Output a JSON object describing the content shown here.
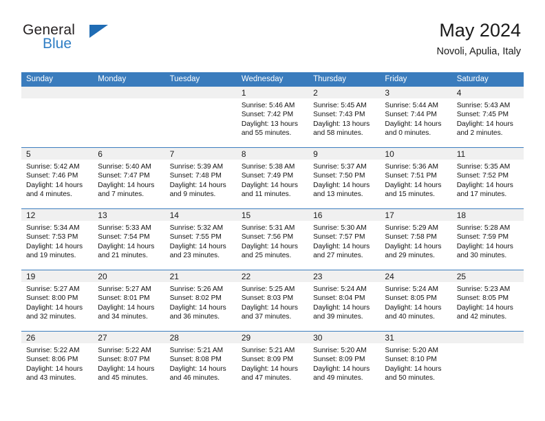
{
  "brand": {
    "name_part1": "General",
    "name_part2": "Blue",
    "logo_icon": "triangle-logo-icon",
    "accent_color": "#2e7dc4"
  },
  "header": {
    "month_title": "May 2024",
    "location": "Novoli, Apulia, Italy"
  },
  "calendar": {
    "header_color": "#3a7cbd",
    "daynum_band_color": "#f0f0f0",
    "weekday_labels": [
      "Sunday",
      "Monday",
      "Tuesday",
      "Wednesday",
      "Thursday",
      "Friday",
      "Saturday"
    ],
    "weeks": [
      [
        {
          "day": "",
          "sunrise": "",
          "sunset": "",
          "daylight_line1": "",
          "daylight_line2": ""
        },
        {
          "day": "",
          "sunrise": "",
          "sunset": "",
          "daylight_line1": "",
          "daylight_line2": ""
        },
        {
          "day": "",
          "sunrise": "",
          "sunset": "",
          "daylight_line1": "",
          "daylight_line2": ""
        },
        {
          "day": "1",
          "sunrise": "Sunrise: 5:46 AM",
          "sunset": "Sunset: 7:42 PM",
          "daylight_line1": "Daylight: 13 hours",
          "daylight_line2": "and 55 minutes."
        },
        {
          "day": "2",
          "sunrise": "Sunrise: 5:45 AM",
          "sunset": "Sunset: 7:43 PM",
          "daylight_line1": "Daylight: 13 hours",
          "daylight_line2": "and 58 minutes."
        },
        {
          "day": "3",
          "sunrise": "Sunrise: 5:44 AM",
          "sunset": "Sunset: 7:44 PM",
          "daylight_line1": "Daylight: 14 hours",
          "daylight_line2": "and 0 minutes."
        },
        {
          "day": "4",
          "sunrise": "Sunrise: 5:43 AM",
          "sunset": "Sunset: 7:45 PM",
          "daylight_line1": "Daylight: 14 hours",
          "daylight_line2": "and 2 minutes."
        }
      ],
      [
        {
          "day": "5",
          "sunrise": "Sunrise: 5:42 AM",
          "sunset": "Sunset: 7:46 PM",
          "daylight_line1": "Daylight: 14 hours",
          "daylight_line2": "and 4 minutes."
        },
        {
          "day": "6",
          "sunrise": "Sunrise: 5:40 AM",
          "sunset": "Sunset: 7:47 PM",
          "daylight_line1": "Daylight: 14 hours",
          "daylight_line2": "and 7 minutes."
        },
        {
          "day": "7",
          "sunrise": "Sunrise: 5:39 AM",
          "sunset": "Sunset: 7:48 PM",
          "daylight_line1": "Daylight: 14 hours",
          "daylight_line2": "and 9 minutes."
        },
        {
          "day": "8",
          "sunrise": "Sunrise: 5:38 AM",
          "sunset": "Sunset: 7:49 PM",
          "daylight_line1": "Daylight: 14 hours",
          "daylight_line2": "and 11 minutes."
        },
        {
          "day": "9",
          "sunrise": "Sunrise: 5:37 AM",
          "sunset": "Sunset: 7:50 PM",
          "daylight_line1": "Daylight: 14 hours",
          "daylight_line2": "and 13 minutes."
        },
        {
          "day": "10",
          "sunrise": "Sunrise: 5:36 AM",
          "sunset": "Sunset: 7:51 PM",
          "daylight_line1": "Daylight: 14 hours",
          "daylight_line2": "and 15 minutes."
        },
        {
          "day": "11",
          "sunrise": "Sunrise: 5:35 AM",
          "sunset": "Sunset: 7:52 PM",
          "daylight_line1": "Daylight: 14 hours",
          "daylight_line2": "and 17 minutes."
        }
      ],
      [
        {
          "day": "12",
          "sunrise": "Sunrise: 5:34 AM",
          "sunset": "Sunset: 7:53 PM",
          "daylight_line1": "Daylight: 14 hours",
          "daylight_line2": "and 19 minutes."
        },
        {
          "day": "13",
          "sunrise": "Sunrise: 5:33 AM",
          "sunset": "Sunset: 7:54 PM",
          "daylight_line1": "Daylight: 14 hours",
          "daylight_line2": "and 21 minutes."
        },
        {
          "day": "14",
          "sunrise": "Sunrise: 5:32 AM",
          "sunset": "Sunset: 7:55 PM",
          "daylight_line1": "Daylight: 14 hours",
          "daylight_line2": "and 23 minutes."
        },
        {
          "day": "15",
          "sunrise": "Sunrise: 5:31 AM",
          "sunset": "Sunset: 7:56 PM",
          "daylight_line1": "Daylight: 14 hours",
          "daylight_line2": "and 25 minutes."
        },
        {
          "day": "16",
          "sunrise": "Sunrise: 5:30 AM",
          "sunset": "Sunset: 7:57 PM",
          "daylight_line1": "Daylight: 14 hours",
          "daylight_line2": "and 27 minutes."
        },
        {
          "day": "17",
          "sunrise": "Sunrise: 5:29 AM",
          "sunset": "Sunset: 7:58 PM",
          "daylight_line1": "Daylight: 14 hours",
          "daylight_line2": "and 29 minutes."
        },
        {
          "day": "18",
          "sunrise": "Sunrise: 5:28 AM",
          "sunset": "Sunset: 7:59 PM",
          "daylight_line1": "Daylight: 14 hours",
          "daylight_line2": "and 30 minutes."
        }
      ],
      [
        {
          "day": "19",
          "sunrise": "Sunrise: 5:27 AM",
          "sunset": "Sunset: 8:00 PM",
          "daylight_line1": "Daylight: 14 hours",
          "daylight_line2": "and 32 minutes."
        },
        {
          "day": "20",
          "sunrise": "Sunrise: 5:27 AM",
          "sunset": "Sunset: 8:01 PM",
          "daylight_line1": "Daylight: 14 hours",
          "daylight_line2": "and 34 minutes."
        },
        {
          "day": "21",
          "sunrise": "Sunrise: 5:26 AM",
          "sunset": "Sunset: 8:02 PM",
          "daylight_line1": "Daylight: 14 hours",
          "daylight_line2": "and 36 minutes."
        },
        {
          "day": "22",
          "sunrise": "Sunrise: 5:25 AM",
          "sunset": "Sunset: 8:03 PM",
          "daylight_line1": "Daylight: 14 hours",
          "daylight_line2": "and 37 minutes."
        },
        {
          "day": "23",
          "sunrise": "Sunrise: 5:24 AM",
          "sunset": "Sunset: 8:04 PM",
          "daylight_line1": "Daylight: 14 hours",
          "daylight_line2": "and 39 minutes."
        },
        {
          "day": "24",
          "sunrise": "Sunrise: 5:24 AM",
          "sunset": "Sunset: 8:05 PM",
          "daylight_line1": "Daylight: 14 hours",
          "daylight_line2": "and 40 minutes."
        },
        {
          "day": "25",
          "sunrise": "Sunrise: 5:23 AM",
          "sunset": "Sunset: 8:05 PM",
          "daylight_line1": "Daylight: 14 hours",
          "daylight_line2": "and 42 minutes."
        }
      ],
      [
        {
          "day": "26",
          "sunrise": "Sunrise: 5:22 AM",
          "sunset": "Sunset: 8:06 PM",
          "daylight_line1": "Daylight: 14 hours",
          "daylight_line2": "and 43 minutes."
        },
        {
          "day": "27",
          "sunrise": "Sunrise: 5:22 AM",
          "sunset": "Sunset: 8:07 PM",
          "daylight_line1": "Daylight: 14 hours",
          "daylight_line2": "and 45 minutes."
        },
        {
          "day": "28",
          "sunrise": "Sunrise: 5:21 AM",
          "sunset": "Sunset: 8:08 PM",
          "daylight_line1": "Daylight: 14 hours",
          "daylight_line2": "and 46 minutes."
        },
        {
          "day": "29",
          "sunrise": "Sunrise: 5:21 AM",
          "sunset": "Sunset: 8:09 PM",
          "daylight_line1": "Daylight: 14 hours",
          "daylight_line2": "and 47 minutes."
        },
        {
          "day": "30",
          "sunrise": "Sunrise: 5:20 AM",
          "sunset": "Sunset: 8:09 PM",
          "daylight_line1": "Daylight: 14 hours",
          "daylight_line2": "and 49 minutes."
        },
        {
          "day": "31",
          "sunrise": "Sunrise: 5:20 AM",
          "sunset": "Sunset: 8:10 PM",
          "daylight_line1": "Daylight: 14 hours",
          "daylight_line2": "and 50 minutes."
        },
        {
          "day": "",
          "sunrise": "",
          "sunset": "",
          "daylight_line1": "",
          "daylight_line2": ""
        }
      ]
    ]
  }
}
